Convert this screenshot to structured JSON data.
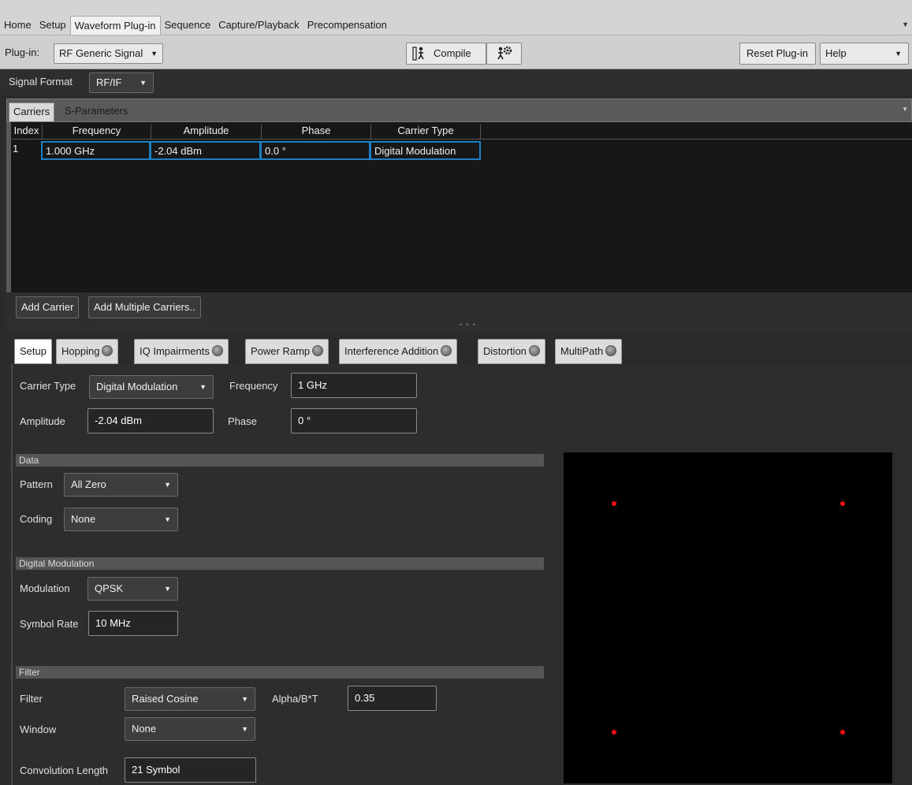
{
  "menu": {
    "items": [
      "Home",
      "Setup",
      "Waveform Plug-in",
      "Sequence",
      "Capture/Playback",
      "Precompensation"
    ],
    "active": "Waveform Plug-in"
  },
  "plugin_bar": {
    "plugin_label": "Plug-in:",
    "plugin_value": "RF Generic Signal",
    "compile_label": "Compile",
    "reset_label": "Reset Plug-in",
    "help_label": "Help"
  },
  "signal_format": {
    "label": "Signal Format",
    "value": "RF/IF"
  },
  "carrier_tabs": [
    "Carriers",
    "S-Parameters"
  ],
  "carrier_table": {
    "columns": [
      "Index",
      "Frequency",
      "Amplitude",
      "Phase",
      "Carrier Type"
    ],
    "rows": [
      {
        "index": "1",
        "frequency": "1.000 GHz",
        "amplitude": "-2.04 dBm",
        "phase": "0.0 °",
        "carrier_type": "Digital Modulation"
      }
    ]
  },
  "carrier_buttons": {
    "add": "Add Carrier",
    "add_multiple": "Add Multiple Carriers.."
  },
  "setup_tabs": [
    {
      "label": "Setup",
      "led": false
    },
    {
      "label": "Hopping",
      "led": true
    },
    {
      "label": "IQ Impairments",
      "led": true
    },
    {
      "label": "Power Ramp",
      "led": true
    },
    {
      "label": "Interference Addition",
      "led": true
    },
    {
      "label": "Distortion",
      "led": true
    },
    {
      "label": "MultiPath",
      "led": true
    }
  ],
  "setup": {
    "carrier_type_label": "Carrier Type",
    "carrier_type_value": "Digital Modulation",
    "frequency_label": "Frequency",
    "frequency_value": "1 GHz",
    "amplitude_label": "Amplitude",
    "amplitude_value": "-2.04 dBm",
    "phase_label": "Phase",
    "phase_value": "0 °"
  },
  "data_section": {
    "title": "Data",
    "pattern_label": "Pattern",
    "pattern_value": "All Zero",
    "coding_label": "Coding",
    "coding_value": "None"
  },
  "modulation_section": {
    "title": "Digital Modulation",
    "modulation_label": "Modulation",
    "modulation_value": "QPSK",
    "symbol_rate_label": "Symbol Rate",
    "symbol_rate_value": "10 MHz"
  },
  "filter_section": {
    "title": "Filter",
    "filter_label": "Filter",
    "filter_value": "Raised Cosine",
    "alpha_label": "Alpha/B*T",
    "alpha_value": "0.35",
    "window_label": "Window",
    "window_value": "None",
    "conv_label": "Convolution Length",
    "conv_value": "21 Symbol"
  },
  "constellation": {
    "modulation": "QPSK",
    "points": [
      [
        -1,
        1
      ],
      [
        1,
        1
      ],
      [
        -1,
        -1
      ],
      [
        1,
        -1
      ]
    ],
    "point_color": "#ff1010",
    "background": "#000000"
  }
}
